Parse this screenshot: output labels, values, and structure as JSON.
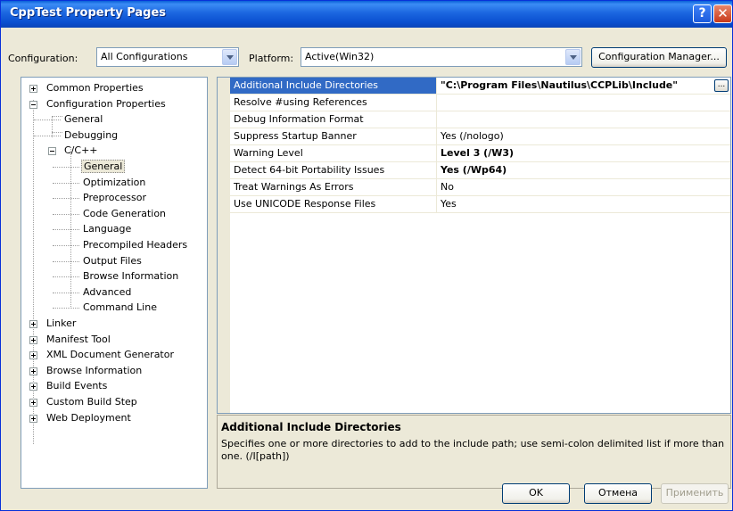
{
  "window": {
    "title": "CppTest Property Pages",
    "help_glyph": "?",
    "close_glyph": "✕"
  },
  "config": {
    "configuration_label": "Configuration:",
    "configuration_value": "All Configurations",
    "platform_label": "Platform:",
    "platform_value": "Active(Win32)",
    "manager_button": "Configuration Manager..."
  },
  "tree": {
    "items": [
      {
        "label": "Common Properties",
        "expander": "plus"
      },
      {
        "label": "Configuration Properties",
        "expander": "minus"
      },
      {
        "label": "General"
      },
      {
        "label": "Debugging"
      },
      {
        "label": "C/C++",
        "expander": "minus"
      },
      {
        "label": "General",
        "selected": true
      },
      {
        "label": "Optimization"
      },
      {
        "label": "Preprocessor"
      },
      {
        "label": "Code Generation"
      },
      {
        "label": "Language"
      },
      {
        "label": "Precompiled Headers"
      },
      {
        "label": "Output Files"
      },
      {
        "label": "Browse Information"
      },
      {
        "label": "Advanced"
      },
      {
        "label": "Command Line"
      },
      {
        "label": "Linker",
        "expander": "plus"
      },
      {
        "label": "Manifest Tool",
        "expander": "plus"
      },
      {
        "label": "XML Document Generator",
        "expander": "plus"
      },
      {
        "label": "Browse Information",
        "expander": "plus"
      },
      {
        "label": "Build Events",
        "expander": "plus"
      },
      {
        "label": "Custom Build Step",
        "expander": "plus"
      },
      {
        "label": "Web Deployment",
        "expander": "plus"
      }
    ]
  },
  "properties": {
    "rows": [
      {
        "name": "Additional Include Directories",
        "value": "\"C:\\Program Files\\Nautilus\\CCPLib\\Include\"",
        "bold": true,
        "selected": true,
        "browse_glyph": "..."
      },
      {
        "name": "Resolve #using References",
        "value": ""
      },
      {
        "name": "Debug Information Format",
        "value": ""
      },
      {
        "name": "Suppress Startup Banner",
        "value": "Yes (/nologo)"
      },
      {
        "name": "Warning Level",
        "value": "Level 3 (/W3)",
        "bold": true
      },
      {
        "name": "Detect 64-bit Portability Issues",
        "value": "Yes (/Wp64)",
        "bold": true
      },
      {
        "name": "Treat Warnings As Errors",
        "value": "No"
      },
      {
        "name": "Use UNICODE Response Files",
        "value": "Yes"
      }
    ]
  },
  "description": {
    "title": "Additional Include Directories",
    "text": "Specifies one or more directories to add to the include path; use semi-colon delimited list if more than one. (/I[path])"
  },
  "buttons": {
    "ok": "OK",
    "cancel": "Отмена",
    "apply": "Применить"
  }
}
